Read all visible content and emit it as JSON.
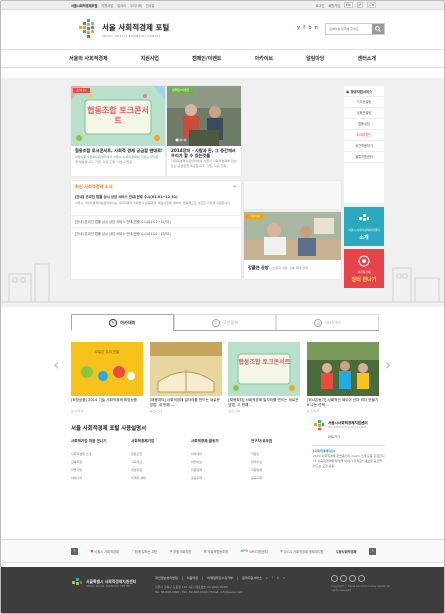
{
  "topbar": {
    "left": [
      "서울시회적경제포털",
      "지원사업",
      "일자리",
      "우리사회",
      "인사말"
    ],
    "right": [
      "로그인",
      "회원가입",
      "EN",
      "JP",
      "CN"
    ]
  },
  "header": {
    "title": "서울 사회적경제 포털",
    "subtitle": "SEOUL SOCIAL ECONOMY PORTAL",
    "social": [
      "y",
      "f",
      "b",
      "n"
    ],
    "search_placeholder": "검색어를 입력해 주세요"
  },
  "nav": [
    "서울의 사회적경제",
    "지원사업",
    "캠페인/이벤트",
    "아카이브",
    "알림마당",
    "센터소개"
  ],
  "cards": {
    "feature1": {
      "tag": "소식나누",
      "image_text": "협동조합 토크콘서트",
      "title": "협동조합 토크콘서트, 사회적 경제 궁금할 땐대로!",
      "desc": "서울사회적경제지원센터에서 서울시 사회적경제에 걱정는 궁금증을 해결합니다. 기업, 자료 조회, 서울 기업등"
    },
    "feature2": {
      "tag": "캠페인/이벤트",
      "title": "2014장터 - 사람과 돈, 그 중간에서 우리가 할 수 있는것들",
      "desc": "사회적경제지원센터에서 서울시 사회적경제에 관심있는 공급망을 제공합니다. 기업, 자료 조회"
    },
    "news": {
      "title": "최신 사회적경제 소식",
      "items": [
        "[안내] 온라인 법률 상시 상담 서비스 안내(연중 수시(01.01~12.31)",
        "서울시 사회적경제지원센터에서는 사회적경제 주체들의 활동과정, 애로사항에 대하여, 법률적으로 필요한 사항을 지원합니다",
        "[안내] 온라인 법률 상시 상담 서비스 안내(연중 수시(01.01~12/31)",
        "[안내] 온라인 법률 상시 상담 서비스 안내(연중 수시(01.01~12/31)"
      ]
    },
    "feature3": {
      "tag": "기업사람",
      "title": "강풀쓴 공방",
      "desc": "전문화 의료, 소통 재미 연대"
    }
  },
  "sidebox": {
    "title": "경영지원서비스",
    "items": [
      "기초컨설팅",
      "심화컨설팅",
      "법률상담",
      "회계지원단",
      "공간활용하기",
      "물류지원센터"
    ]
  },
  "banners": {
    "b1_small": "서울시 사회적경제지원센터",
    "b1_big": "소개",
    "b2_small": "사회적경제",
    "b2_big": "장터 만나기"
  },
  "tabs": [
    "아카데미",
    "구인정보",
    "아카이브"
  ],
  "thumbs": [
    {
      "title": "[희망상품] 2014 기술 사회적경제 희망상품",
      "date": "뉴스/기사"
    },
    {
      "title": "[채용파티] 사회적경제 일자리를 만드는 새로운 방법, 새 번째 ...",
      "date": "뉴스/기사"
    },
    {
      "title": "[채용파티] 사회적경제 일자리를 만드는 새로운 방법, 두 번째 ...",
      "date": "뉴스/기사"
    },
    {
      "title": "[위니온동기] 사회적인 제도이 산다 죄다 만들기 8 나는 선택 ...",
      "date": "뉴스/기사"
    }
  ],
  "thumb_images": [
    "오늘은 우리 뜻을",
    "협동조합 토크콘서트",
    "",
    ""
  ],
  "guide": {
    "title": "서울 사회적경제 포털 사용설명서",
    "cols": [
      {
        "head": "사회적기업 처음 만나기",
        "items": [
          "사회적경제 소개",
          "교육지원",
          "마을기업",
          "아이디어"
        ]
      },
      {
        "head": "사회적경제기업",
        "items": [
          "협동조합",
          "사회혁신",
          "경영지원",
          "지역화 생태"
        ]
      },
      {
        "head": "사회적경제 활동가",
        "items": [
          "아카데미",
          "아카이브",
          "지원정책",
          "공공구매"
        ]
      },
      {
        "head": "연구자/공무원",
        "items": [
          "자문단",
          "아카이브",
          "지원정책",
          "공공구매"
        ]
      }
    ]
  },
  "center": {
    "title": "서울시사회적경제지원센터",
    "sub": "Seoul Social Economy Center",
    "caption": "바로가기",
    "news_tag": "[사회적경제지원]",
    "news_text": "2014 사회적경제 학습동아리 moim 소개 모음 모집합니다. 사회적경제와 무엇을 이야기 할까요? 새로운 공간을 만드는 모임 등등"
  },
  "partners": [
    "서울시 사회적경제",
    "함께 일하는 재단",
    "보험사회지원",
    "사회적협동조합",
    "NPO지원센터",
    "2015 사회적경제 생태계지원",
    "도봉사회적경제"
  ],
  "footer": {
    "logo1": "서울특별시 사회적경제지원센터",
    "logo2": "SEOUL SOCIAL ECONOMY CENTER",
    "links": [
      "개인정보처리방침",
      "이용약관",
      "이메일무단수집거부",
      "원격지원서비스"
    ],
    "social": [
      "y",
      "f",
      "b",
      "n"
    ],
    "addr1": "서울시 강북구 도봉로 110 1층 | 대표번호 02-2000-0000",
    "addr2": "Tel. 02-000-0000 / Fax. 02-000-0000 / Email. info@seoul.net",
    "copy": "Copyright ⓒ Seoul Social Economy Center All rights reserved."
  }
}
